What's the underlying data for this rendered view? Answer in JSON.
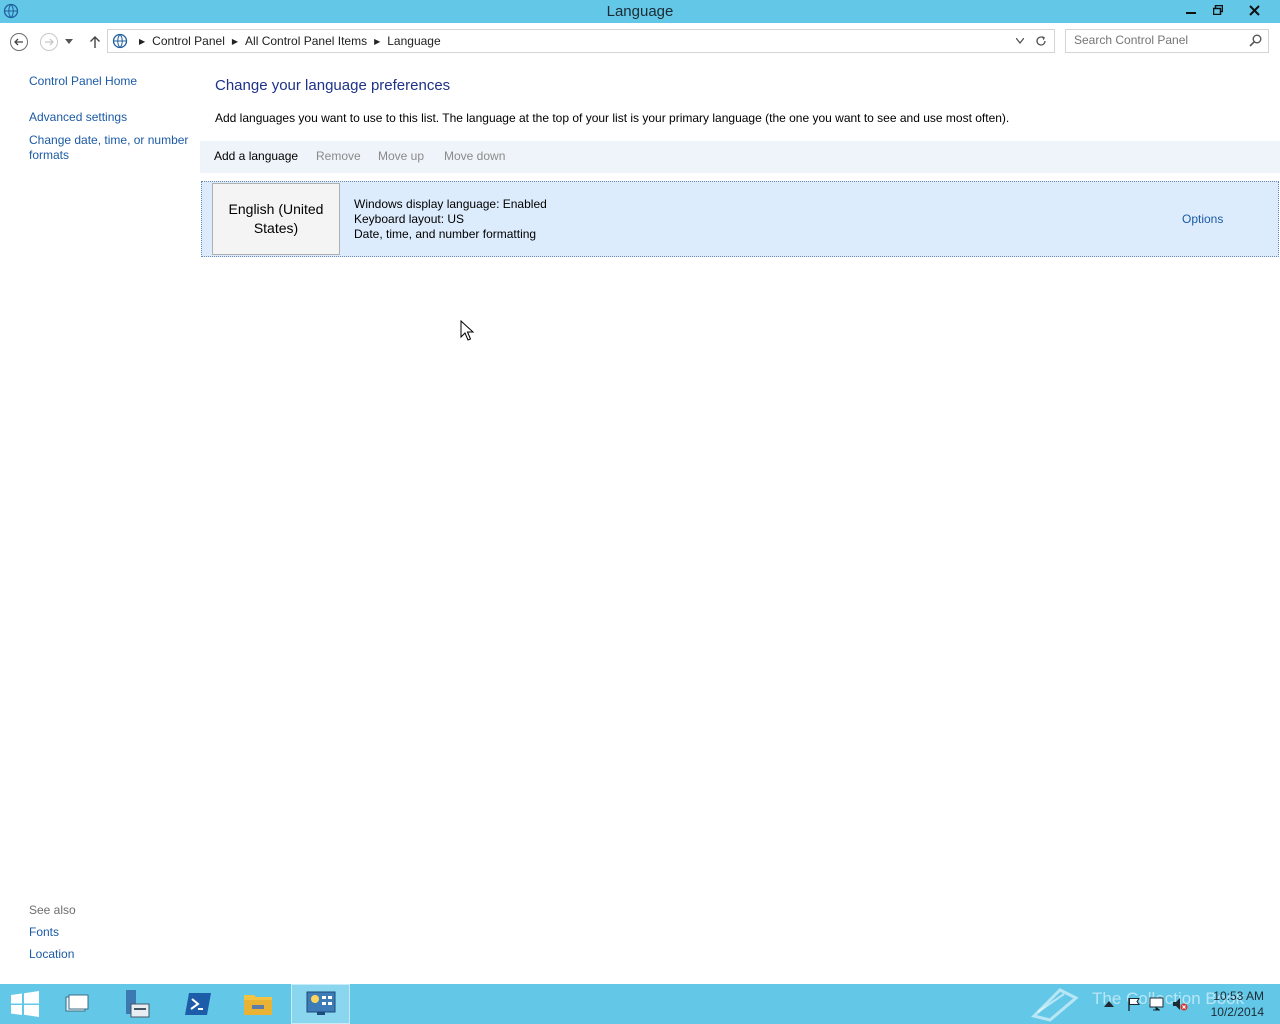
{
  "window": {
    "title": "Language"
  },
  "address_bar": {
    "crumbs": [
      "Control Panel",
      "All Control Panel Items",
      "Language"
    ]
  },
  "search": {
    "placeholder": "Search Control Panel"
  },
  "left_nav": {
    "home": "Control Panel Home",
    "links": [
      "Advanced settings",
      "Change date, time, or number formats"
    ],
    "see_also_header": "See also",
    "see_also": [
      "Fonts",
      "Location"
    ]
  },
  "main": {
    "title": "Change your language preferences",
    "description": "Add languages you want to use to this list. The language at the top of your list is your primary language (the one you want to see and use most often).",
    "toolbar": {
      "add": "Add a language",
      "remove": "Remove",
      "move_up": "Move up",
      "move_down": "Move down"
    },
    "languages": [
      {
        "name": "English (United States)",
        "details": [
          "Windows display language: Enabled",
          "Keyboard layout: US",
          "Date, time, and number formatting"
        ],
        "options_label": "Options"
      }
    ]
  },
  "taskbar": {
    "clock_time": "10:53 AM",
    "clock_date": "10/2/2014",
    "watermark": "The Collection Book"
  },
  "colors": {
    "accent": "#63c8e8",
    "link": "#1b5aa5",
    "heading": "#1e3287",
    "selected_row": "#ddecfd"
  }
}
